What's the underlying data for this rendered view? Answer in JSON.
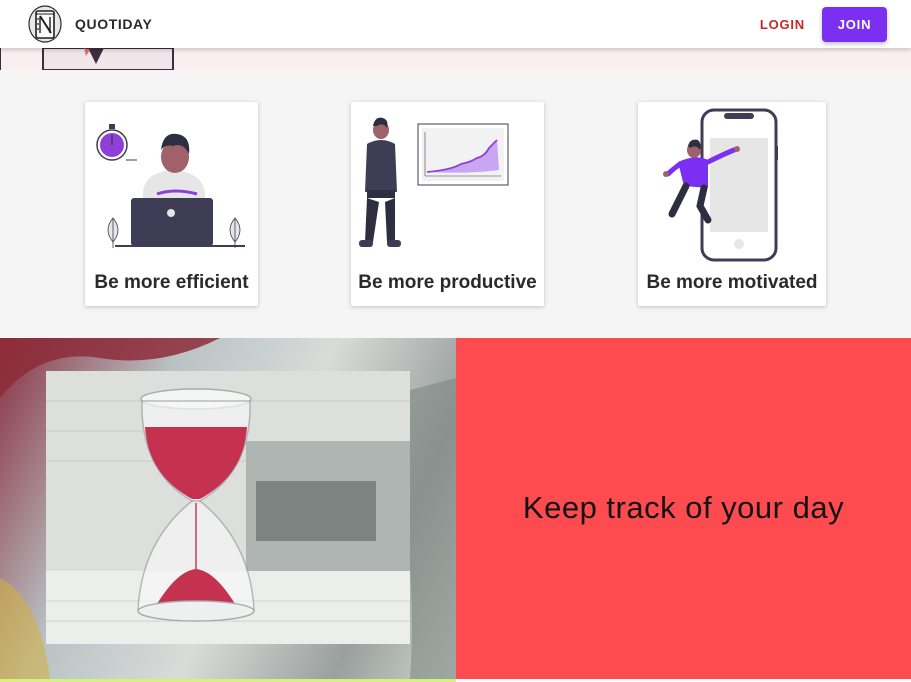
{
  "navbar": {
    "brand": "QUOTIDAY",
    "login_label": "LOGIN",
    "join_label": "JOIN"
  },
  "features": [
    {
      "title": "Be more efficient"
    },
    {
      "title": "Be more productive"
    },
    {
      "title": "Be more motivated"
    }
  ],
  "promo": {
    "headline": "Keep track of your day"
  },
  "colors": {
    "accent_purple": "#7b2ff2",
    "login_red": "#c62828",
    "promo_red": "#fd4b4f"
  }
}
